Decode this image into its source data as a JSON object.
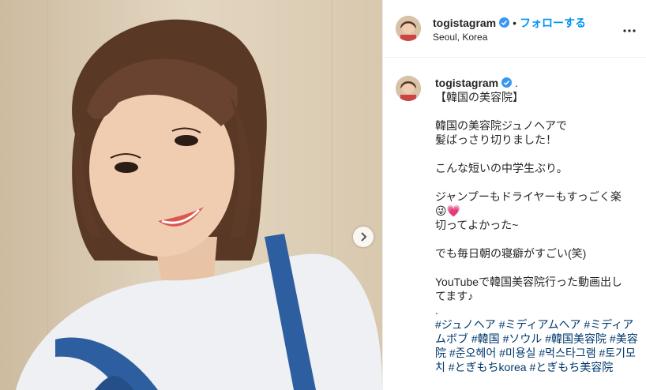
{
  "post": {
    "username": "togistagram",
    "location": "Seoul, Korea",
    "separator": "•",
    "follow_label": "フォローする",
    "verified_icon": "verified-badge-icon",
    "accent_color": "#0095f6",
    "hashtag_color": "#00376b"
  },
  "caption": {
    "username": "togistagram",
    "trailing": ".",
    "title": "【韓国の美容院】",
    "line1": "韓国の美容院ジュノヘアで",
    "line2": "髪ばっさり切りました！",
    "line3": "こんな短いの中学生ぶり。",
    "line4": "ジャンプーもドライヤーもすっごく楽",
    "line5": "😜💗",
    "line6": "切ってよかった~",
    "line7": "でも毎日朝の寝癖がすごい(笑)",
    "line8": "YouTubeで韓国美容院行った動画出し",
    "line9": "てます♪",
    "line10": ".",
    "hashtags": "#ジュノヘア #ミディアムヘア #ミディアムボブ #韓国 #ソウル #韓国美容院 #美容院 #준오헤어 #미용실 #먹스타그램 #토기모치 #とぎもちkorea #とぎもち美容院"
  },
  "icons": {
    "next": "chevron-right-icon",
    "more": "more-options-icon"
  }
}
